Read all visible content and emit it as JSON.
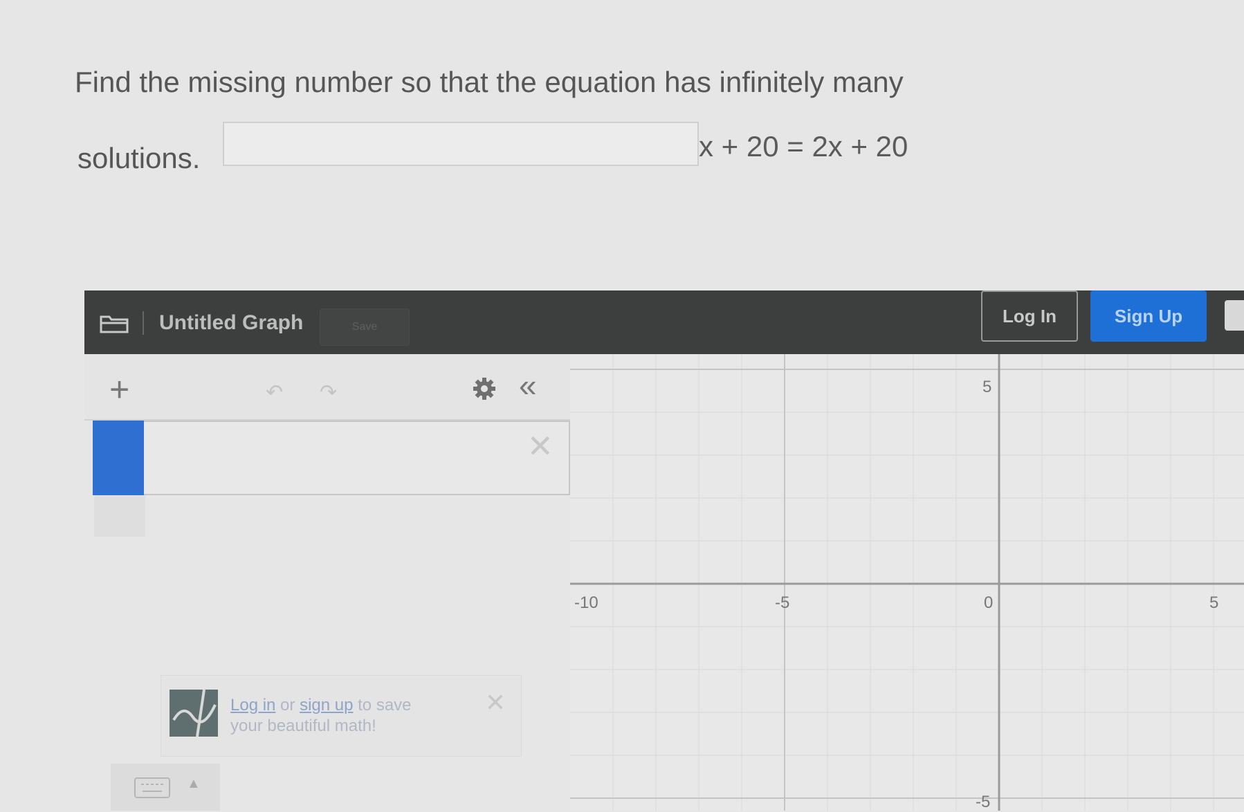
{
  "question": {
    "line1": "Find the missing number so that the equation has infinitely many",
    "line2": "solutions.",
    "answer_value": "",
    "equation_suffix": "x + 20 = 2x + 20"
  },
  "topbar": {
    "graph_title": "Untitled Graph",
    "save_label": "Save",
    "login_label": "Log In",
    "signup_label": "Sign Up"
  },
  "expression_panel": {
    "expression_value": ""
  },
  "save_notice": {
    "link_login": "Log in",
    "middle": " or ",
    "link_signup": "sign up",
    "tail": " to save",
    "line2": "your beautiful math!"
  },
  "footer": {
    "help_text": ""
  },
  "graph": {
    "x_ticks": [
      "-10",
      "-5",
      "0",
      "5"
    ],
    "y_ticks": [
      "5",
      "-5"
    ]
  },
  "icons": {
    "folder": "folder-icon",
    "add": "plus-icon",
    "undo": "undo-icon",
    "redo": "redo-icon",
    "settings": "gear-icon",
    "collapse": "double-chevron-left-icon",
    "delete": "close-icon",
    "keyboard": "keyboard-icon"
  },
  "colors": {
    "topbar_bg": "#3d3f3f",
    "signup_blue": "#1f70d6",
    "expression_color": "#2d70d2"
  }
}
